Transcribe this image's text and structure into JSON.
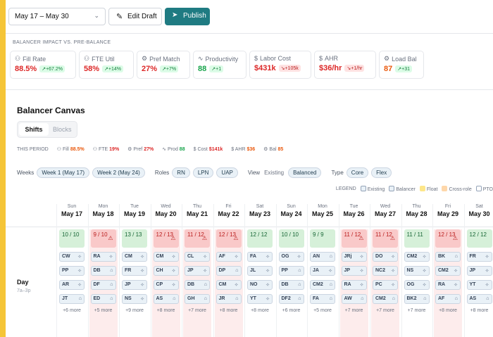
{
  "toolbar": {
    "date_range": "May 17 – May 30",
    "edit_label": "Edit Draft",
    "publish_label": "Publish"
  },
  "impact": {
    "title": "BALANCER IMPACT VS. PRE-BALANCE",
    "metrics": [
      {
        "label": "Fill Rate",
        "icon": "people-icon",
        "value": "88.5%",
        "value_color": "red",
        "delta": "+67.2%",
        "delta_type": "g"
      },
      {
        "label": "FTE Util",
        "icon": "people-icon",
        "value": "58%",
        "value_color": "red",
        "delta": "+14%",
        "delta_type": "g"
      },
      {
        "label": "Pref Match",
        "icon": "gear-icon",
        "value": "27%",
        "value_color": "red",
        "delta": "+7%",
        "delta_type": "g"
      },
      {
        "label": "Productivity",
        "icon": "pulse-icon",
        "value": "88",
        "value_color": "green",
        "delta": "+1",
        "delta_type": "g"
      },
      {
        "label": "Labor Cost",
        "icon": "dollar-icon",
        "value": "$431k",
        "value_color": "red",
        "delta": "+105k",
        "delta_type": "r"
      },
      {
        "label": "AHR",
        "icon": "dollar-icon",
        "value": "$36/hr",
        "value_color": "red",
        "delta": "+1/hr",
        "delta_type": "r"
      },
      {
        "label": "Load Bal",
        "icon": "gear-icon",
        "value": "87",
        "value_color": "orange",
        "delta": "+31",
        "delta_type": "g"
      }
    ]
  },
  "canvas": {
    "title": "Balancer Canvas",
    "tab_shifts": "Shifts",
    "tab_blocks": "Blocks",
    "period_label": "THIS PERIOD",
    "period": [
      {
        "label": "Fill",
        "value": "88.5%",
        "color": "orange"
      },
      {
        "label": "FTE",
        "value": "19%",
        "color": "red"
      },
      {
        "label": "Pref",
        "value": "27%",
        "color": "red"
      },
      {
        "label": "Prod",
        "value": "88",
        "color": "green"
      },
      {
        "label": "Cost",
        "value": "$141k",
        "color": "red"
      },
      {
        "label": "AHR",
        "value": "$36",
        "color": "orange"
      },
      {
        "label": "Bal",
        "value": "85",
        "color": "orange"
      }
    ],
    "filters": {
      "weeks_label": "Weeks",
      "week1": "Week 1 (May 17)",
      "week2": "Week 2 (May 24)",
      "roles_label": "Roles",
      "roles": [
        "RN",
        "LPN",
        "UAP"
      ],
      "view_label": "View",
      "view_existing": "Existing",
      "view_balanced": "Balanced",
      "type_label": "Type",
      "type_core": "Core",
      "type_flex": "Flex"
    },
    "legend": {
      "label": "LEGEND",
      "items": [
        "Existing",
        "Balancer",
        "Float",
        "Cross-role",
        "PTO"
      ]
    },
    "row": {
      "label": "Day",
      "hours": "7a–3p"
    },
    "days": [
      {
        "dn": "Sun",
        "dd": "May 17",
        "count": "10 / 10",
        "status": "g",
        "shifts": [
          "CW",
          "PP",
          "AR",
          "JT"
        ],
        "icons": [
          "✧",
          "✧",
          "✧",
          "⌂"
        ],
        "more": "+6 more"
      },
      {
        "dn": "Mon",
        "dd": "May 18",
        "count": "9 / 10",
        "status": "r",
        "shifts": [
          "RA",
          "DB",
          "DF",
          "ED"
        ],
        "icons": [
          "✧",
          "⌂",
          "⌂",
          "⌂"
        ],
        "more": "+5 more"
      },
      {
        "dn": "Tue",
        "dd": "May 19",
        "count": "13 / 13",
        "status": "g",
        "shifts": [
          "CM",
          "FR",
          "JP",
          "NS"
        ],
        "icons": [
          "✧",
          "✧",
          "✧",
          "✧"
        ],
        "more": "+9 more"
      },
      {
        "dn": "Wed",
        "dd": "May 20",
        "count": "12 / 13",
        "status": "r",
        "shifts": [
          "CM",
          "CH",
          "CP",
          "AS"
        ],
        "icons": [
          "✧",
          "✧",
          "✧",
          "⌂"
        ],
        "more": "+8 more"
      },
      {
        "dn": "Thu",
        "dd": "May 21",
        "count": "11 / 12",
        "status": "r",
        "shifts": [
          "CL",
          "JP",
          "DB",
          "GH"
        ],
        "icons": [
          "✧",
          "✧",
          "⌂",
          "⌂"
        ],
        "more": "+7 more"
      },
      {
        "dn": "Fri",
        "dd": "May 22",
        "count": "12 / 13",
        "status": "r",
        "shifts": [
          "AF",
          "DP",
          "CM",
          "JR"
        ],
        "icons": [
          "✧",
          "⌂",
          "✧",
          "⌂"
        ],
        "more": "+8 more"
      },
      {
        "dn": "Sat",
        "dd": "May 23",
        "count": "12 / 12",
        "status": "g",
        "shifts": [
          "FA",
          "JL",
          "NO",
          "YT"
        ],
        "icons": [
          "✧",
          "✧",
          "✧",
          "✧"
        ],
        "more": "+8 more"
      },
      {
        "dn": "Sun",
        "dd": "May 24",
        "count": "10 / 10",
        "status": "g",
        "shifts": [
          "OG",
          "PP",
          "DB",
          "DF2"
        ],
        "icons": [
          "✧",
          "⌂",
          "⌂",
          "⌂"
        ],
        "more": "+6 more"
      },
      {
        "dn": "Mon",
        "dd": "May 25",
        "count": "9 / 9",
        "status": "g",
        "shifts": [
          "AN",
          "JA",
          "CM2",
          "FA"
        ],
        "icons": [
          "⌂",
          "✧",
          "⌂",
          "⌂"
        ],
        "more": "+5 more"
      },
      {
        "dn": "Tue",
        "dd": "May 26",
        "count": "11 / 12",
        "status": "r",
        "shifts": [
          "JRj",
          "JP",
          "RA",
          "AW"
        ],
        "icons": [
          "✧",
          "✧",
          "✧",
          "⌂"
        ],
        "more": "+7 more"
      },
      {
        "dn": "Wed",
        "dd": "May 27",
        "count": "11 / 12",
        "status": "r",
        "shifts": [
          "DO",
          "NC2",
          "PC",
          "CM2"
        ],
        "icons": [
          "✧",
          "✧",
          "✧",
          "⌂"
        ],
        "more": "+7 more"
      },
      {
        "dn": "Thu",
        "dd": "May 28",
        "count": "11 / 11",
        "status": "g",
        "shifts": [
          "CM2",
          "NS",
          "OG",
          "BK2"
        ],
        "icons": [
          "✧",
          "✧",
          "✧",
          "⌂"
        ],
        "more": "+7 more"
      },
      {
        "dn": "Fri",
        "dd": "May 29",
        "count": "12 / 13",
        "status": "r",
        "shifts": [
          "BK",
          "CM2",
          "RA",
          "AF"
        ],
        "icons": [
          "⌂",
          "✧",
          "✧",
          "⌂"
        ],
        "more": "+8 more"
      },
      {
        "dn": "Sat",
        "dd": "May 30",
        "count": "12 / 12",
        "status": "g",
        "shifts": [
          "FR",
          "JP",
          "YT",
          "AS"
        ],
        "icons": [
          "✧",
          "✧",
          "✧",
          "⌂"
        ],
        "more": "+8 more"
      }
    ]
  },
  "colors": {
    "accent": "#1f7b82",
    "red": "#dc2626",
    "green": "#16a34a",
    "orange": "#ea580c"
  }
}
